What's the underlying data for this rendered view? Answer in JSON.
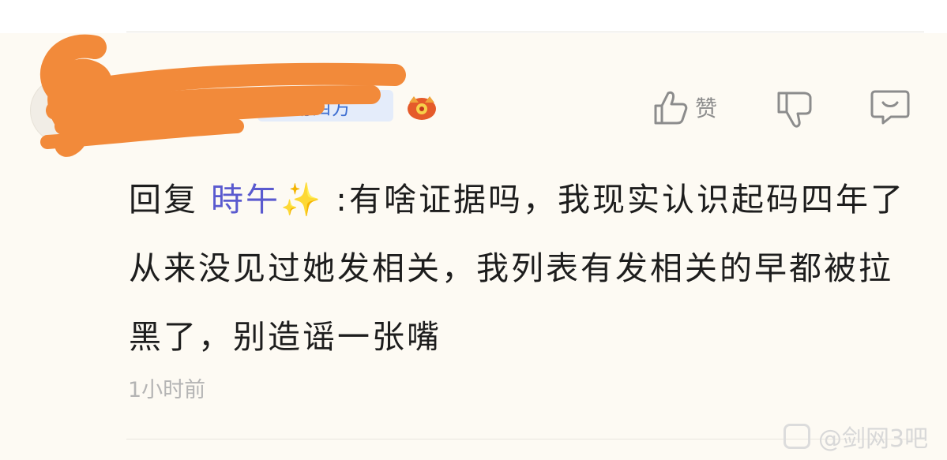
{
  "comment": {
    "badge_label": "动四方",
    "like_label": "赞",
    "reply_prefix": "回复",
    "reply_target": "時午✨",
    "content": "  :有啥证据吗，我现实认识起码四年了从来没见过她发相关，我列表有发相关的早都被拉黑了，别造谣一张嘴",
    "timestamp": "1小时前"
  },
  "watermark": {
    "text": "@剑网3吧"
  },
  "icons": {
    "like": "thumbs-up-icon",
    "dislike": "thumbs-down-icon",
    "comment": "comment-bubble-icon",
    "badge": "badge-icon",
    "game": "game-emblem-icon",
    "watermark": "tieba-logo-icon"
  },
  "colors": {
    "background": "#fdfaf3",
    "reply_target": "#5a5acf",
    "badge_text": "#3e6fd1",
    "redaction": "#f28a3a"
  }
}
